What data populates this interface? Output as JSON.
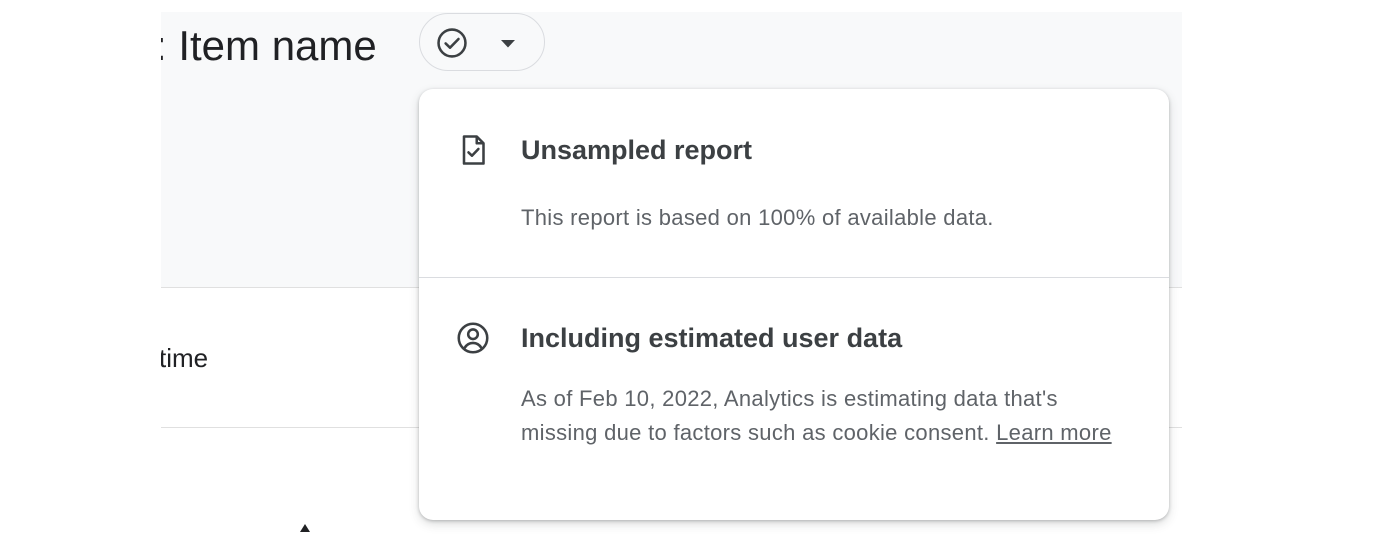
{
  "header": {
    "title": ": Item name",
    "status_icon": "check-circle-icon",
    "dropdown_icon": "caret-down-icon"
  },
  "table": {
    "visible_column_label": "time",
    "sort_icon": "sort-up-icon"
  },
  "popover": {
    "sections": [
      {
        "icon": "document-check-icon",
        "title": "Unsampled report",
        "description": "This report is based on 100% of available data."
      },
      {
        "icon": "account-circle-icon",
        "title": "Including estimated user data",
        "description": "As of Feb 10, 2022, Analytics is estimating data that's missing due to factors such as cookie consent.",
        "link_text": "Learn more"
      }
    ]
  },
  "colors": {
    "header_background": "#f8f9fa",
    "text_primary": "#202124",
    "text_secondary": "#5f6368",
    "divider": "#dadce0"
  }
}
